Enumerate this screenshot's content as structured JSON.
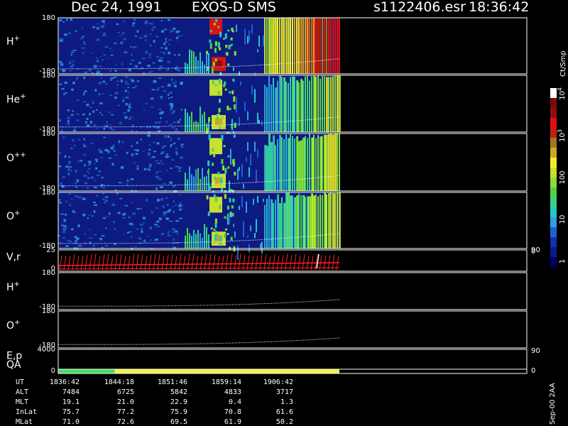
{
  "header": {
    "date": "Dec 24, 1991",
    "instrument": "EXOS-D SMS",
    "file": "s1122406.esr",
    "time": "18:36:42"
  },
  "colors": {
    "background": "#000000",
    "frame": "#ffffff",
    "spectrogram_base": "#0d1a80",
    "velocity_trace": "#ff2020",
    "qa_good": "#3ee05a",
    "qa_caution": "#f2f23c",
    "colorbar": [
      "#000066",
      "#0a1a8a",
      "#1030b0",
      "#1f5fd0",
      "#2ea0e0",
      "#20c8c8",
      "#38d090",
      "#54d040",
      "#8edc30",
      "#c8e030",
      "#f0f028",
      "#c8a828",
      "#a07820",
      "#c02010",
      "#e01010",
      "#8a1010",
      "#7a0a0a",
      "#ffffff"
    ]
  },
  "chart_data": {
    "type": "heatmap",
    "title": "Dec 24, 1991 EXOS-D SMS",
    "x_axis": {
      "quantity": "UT",
      "tick_labels": [
        "1836:42",
        "1844:18",
        "1851:46",
        "1859:14",
        "1906:42"
      ],
      "data_extent_fraction": 0.6
    },
    "panels": [
      {
        "label": "H",
        "superscript": "+",
        "ymin_label": "-180",
        "ymax_label": "180",
        "kind": "spectrogram"
      },
      {
        "label": "He",
        "superscript": "+",
        "ymin_label": "-180",
        "ymax_label": "180",
        "kind": "spectrogram"
      },
      {
        "label": "O",
        "superscript": "++",
        "ymin_label": "-180",
        "ymax_label": "180",
        "kind": "spectrogram"
      },
      {
        "label": "O",
        "superscript": "+",
        "ymin_label": "-180",
        "ymax_label": "180",
        "kind": "spectrogram",
        "right_ylabel": "90"
      },
      {
        "label": "V,r",
        "superscript": "",
        "ymin_label": "0",
        "ymax_label": "25",
        "kind": "velocity",
        "right_ylabel": "0"
      },
      {
        "label": "H",
        "superscript": "+",
        "ymin_label": "-180",
        "ymax_label": "180",
        "kind": "line"
      },
      {
        "label": "O",
        "superscript": "+",
        "ymin_label": "-180",
        "ymax_label": "180",
        "kind": "line"
      },
      {
        "label": "E,p",
        "superscript": "",
        "ymin_label": "",
        "ymax_label": "4000",
        "kind": "empty",
        "right_ylabel": "90"
      },
      {
        "label": "QA",
        "superscript": "",
        "ymin_label": "0",
        "ymax_label": "",
        "kind": "qa",
        "right_ylabel": "0"
      }
    ],
    "colorbar": {
      "label": "Ct/Smp",
      "ticks": [
        {
          "value": 1,
          "label": "1"
        },
        {
          "value": 10,
          "label": "10"
        },
        {
          "value": 100,
          "label": "100"
        },
        {
          "value": 1000,
          "label": "10",
          "exponent": "3"
        },
        {
          "value": 10000,
          "label": "10",
          "exponent": "4"
        }
      ],
      "scale": "log"
    },
    "ephemeris": {
      "rows": [
        {
          "name": "UT",
          "values": [
            "1836:42",
            "1844:18",
            "1851:46",
            "1859:14",
            "1906:42"
          ]
        },
        {
          "name": "ALT",
          "values": [
            "7484",
            "6725",
            "5842",
            "4833",
            "3717"
          ]
        },
        {
          "name": "MLT",
          "values": [
            "19.1",
            "21.0",
            "22.9",
            "0.4",
            "1.3"
          ]
        },
        {
          "name": "InLat",
          "values": [
            "75.7",
            "77.2",
            "75.9",
            "70.8",
            "61.6"
          ]
        },
        {
          "name": "MLat",
          "values": [
            "71.0",
            "72.6",
            "69.5",
            "61.9",
            "50.2"
          ]
        }
      ]
    },
    "qa_segments": [
      {
        "from": 0.0,
        "to": 0.2,
        "status": "good"
      },
      {
        "from": 0.2,
        "to": 1.0,
        "status": "caution"
      }
    ]
  },
  "footer": {
    "version": "Sep-00 2AA"
  }
}
